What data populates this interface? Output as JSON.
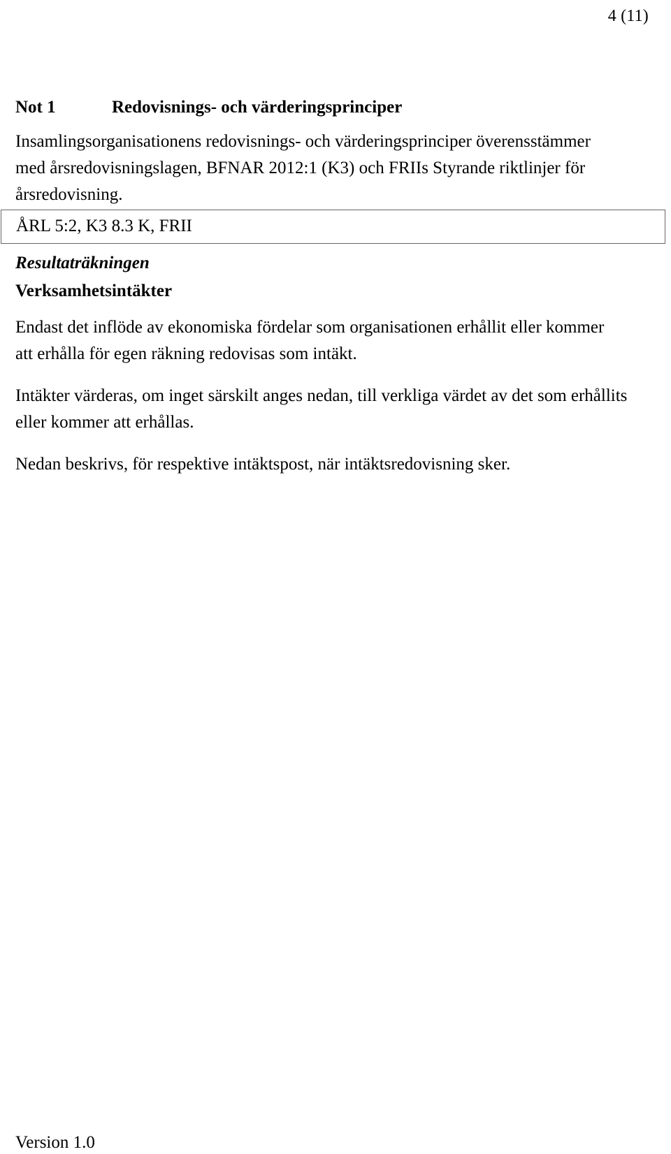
{
  "document": {
    "page_label": "4 (11)",
    "note": {
      "label": "Not 1",
      "title": "Redovisnings- och värderingsprinciper"
    },
    "intro_paragraph": "Insamlingsorganisationens redovisnings- och värderingsprinciper överensstämmer med årsredovisningslagen, BFNAR 2012:1 (K3) och FRIIs Styrande riktlinjer för årsredovisning.",
    "reference_box": {
      "text": "ÅRL 5:2, K3 8.3 K, FRII"
    },
    "subheading_italic": "Resultaträkningen",
    "subheading_bold": "Verksamhetsintäkter",
    "paragraphs": [
      "Endast det inflöde av ekonomiska fördelar som organisationen erhållit eller kommer att erhålla för egen räkning redovisas som intäkt.",
      "Intäkter värderas, om inget särskilt anges nedan, till verkliga värdet av det som erhållits eller kommer att erhållas.",
      "Nedan beskrivs, för respektive intäktspost, när intäktsredovisning sker."
    ],
    "footer": {
      "version": "Version 1.0"
    },
    "colors": {
      "text": "#000000",
      "page_background": "#ffffff",
      "box_border": "#666666"
    }
  }
}
